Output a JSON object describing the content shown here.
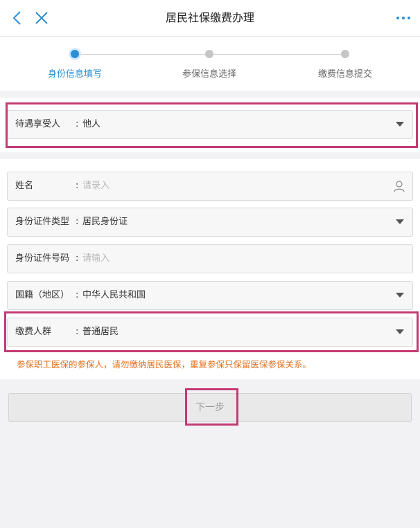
{
  "header": {
    "title": "居民社保缴费办理",
    "back_icon": "chevron-left-icon",
    "close_icon": "close-icon",
    "more_icon": "more-dots-icon"
  },
  "steps": [
    {
      "label": "身份信息填写",
      "active": true
    },
    {
      "label": "参保信息选择",
      "active": false
    },
    {
      "label": "缴费信息提交",
      "active": false
    }
  ],
  "beneficiary": {
    "label": "待遇享受人",
    "colon": ":",
    "value": "他人"
  },
  "form": {
    "name": {
      "label": "姓名",
      "colon": ":",
      "placeholder": "请录入"
    },
    "id_type": {
      "label": "身份证件类型",
      "colon": ":",
      "value": "居民身份证"
    },
    "id_number": {
      "label": "身份证件号码",
      "colon": ":",
      "placeholder": "请输入"
    },
    "nationality": {
      "label": "国籍（地区）",
      "colon": ":",
      "value": "中华人民共和国"
    },
    "payer_group": {
      "label": "缴费人群",
      "colon": ":",
      "value": "普通居民"
    }
  },
  "notice": "参保职工医保的参保人，请勿缴纳居民医保，重复参保只保留医保参保关系。",
  "next_button": "下一步",
  "colors": {
    "accent": "#2b8fd6",
    "highlight": "#c33a73",
    "warning": "#e3701d"
  }
}
